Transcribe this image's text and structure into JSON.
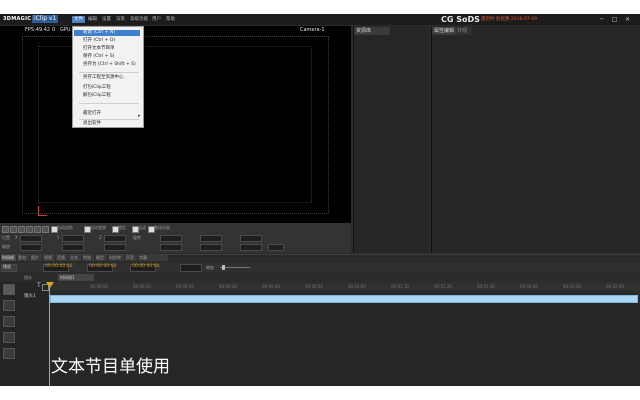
{
  "titlebar": {
    "logo": "3DMAGIC",
    "title": "iClip v1",
    "menus": [
      "文件",
      "编辑",
      "设置",
      "渲染",
      "高级功能",
      "用户",
      "帮助"
    ],
    "brand": "CG SoDS",
    "subbrand": "遇到时 别犹豫 2016-07-09",
    "minimize": "─",
    "maximize": "□",
    "close": "✕"
  },
  "viewport": {
    "fps": "FPS:49.42",
    "fps_tail": "0",
    "gpu": "GPU",
    "camera": "Camera-1"
  },
  "file_menu": {
    "items": [
      {
        "label": "新建 (Ctrl + N)",
        "highlighted": true
      },
      {
        "label": "打开 (Ctrl + O)"
      },
      {
        "label": "打开文本节目单"
      },
      {
        "label": "保存 (Ctrl + S)"
      },
      {
        "label": "另存为 (Ctrl + Shift + S)"
      },
      {
        "label": "另存工程至资源中心"
      },
      {
        "label": "打包iClip工程"
      },
      {
        "label": "解包iClip工程"
      },
      {
        "label": "最近打开"
      },
      {
        "label": "退出软件"
      }
    ]
  },
  "panels": {
    "resources_title": "资源库",
    "properties_title": "属性编辑",
    "properties_tab2": "外观"
  },
  "controls": {
    "check_labels": [
      "自动追踪",
      "自动变换",
      "锁定",
      "运动",
      "路径动画"
    ],
    "row1_labels": [
      "位置",
      "旋转",
      "缩放"
    ],
    "row2_labels": [
      "X",
      "Y",
      "Z"
    ]
  },
  "timeline": {
    "tabs": [
      "时间线",
      "素材",
      "图片",
      "视频",
      "音频",
      "文本",
      "特效",
      "模型",
      "材质库",
      "声音",
      "字幕"
    ],
    "toolbar_label": "播放",
    "current_time": "00:00:00:00",
    "end_time": "00:00:00:00",
    "duration": "00:00:00:00",
    "zoom_label": "缩放",
    "sub_tab": "镜头",
    "sub_tab_active": "时间线1",
    "track_name": "镜头1",
    "ruler_ticks": [
      "00:00:00",
      "00:00:10",
      "00:00:20",
      "00:00:30",
      "00:00:40",
      "00:00:50",
      "00:01:00",
      "00:01:10",
      "00:01:20",
      "00:01:30",
      "00:01:40",
      "00:01:50",
      "00:02:00",
      "00:02:10"
    ]
  },
  "caption": "文本节目单使用",
  "colors": {
    "accent": "#3d7fd1",
    "timecode": "#e0a020",
    "track": "#a9d6f2",
    "brand_red": "#e0562a"
  }
}
